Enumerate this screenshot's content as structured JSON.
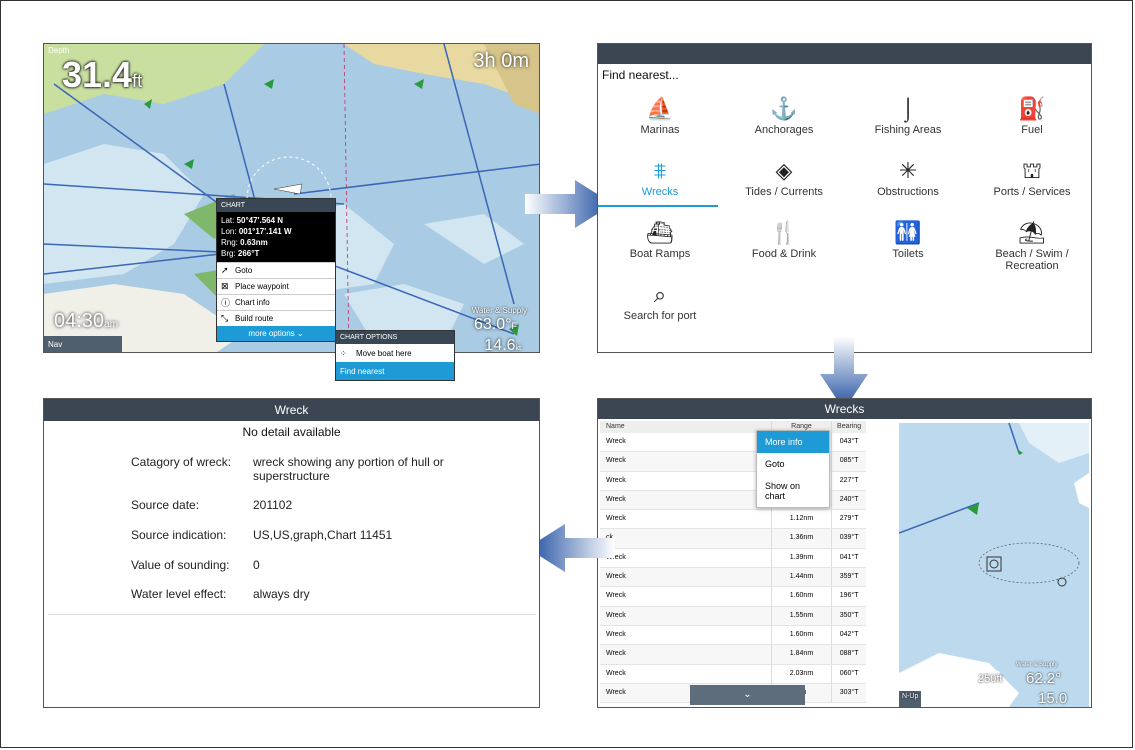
{
  "chart": {
    "depth_label": "Depth",
    "depth_value": "31.4",
    "depth_unit": "ft",
    "eta": "3h 0m",
    "time": "04:30",
    "time_suffix": "am",
    "water_label": "Water & Supply",
    "water_temp": "63.0°",
    "water_temp_unit": "F",
    "speed": "14.6",
    "speed_unit": "kt",
    "bottom_label": "Nav"
  },
  "context_menu": {
    "header": "CHART",
    "lat_label": "Lat:",
    "lat": "50°47'.564 N",
    "lon_label": "Lon:",
    "lon": "001°17'.141 W",
    "rng_label": "Rng:",
    "rng": "0.63nm",
    "brg_label": "Brg:",
    "brg": "266°T",
    "items": [
      "Goto",
      "Place waypoint",
      "Chart info",
      "Build route"
    ],
    "more": "more options"
  },
  "chart_options": {
    "header": "CHART OPTIONS",
    "items": [
      "Move boat here",
      "Find nearest"
    ]
  },
  "find_nearest": {
    "title": "Find nearest...",
    "items": [
      "Marinas",
      "Anchorages",
      "Fishing Areas",
      "Fuel",
      "Wrecks",
      "Tides / Currents",
      "Obstructions",
      "Ports / Services",
      "Boat Ramps",
      "Food & Drink",
      "Toilets",
      "Beach / Swim / Recreation",
      "Search for port"
    ],
    "selected": "Wrecks",
    "accent": "#1e9bd7"
  },
  "wreck_detail": {
    "title": "Wreck",
    "no_detail": "No detail available",
    "rows": [
      {
        "label": "Catagory of wreck:",
        "value": "wreck showing any portion of hull or superstructure"
      },
      {
        "label": "Source date:",
        "value": "201102"
      },
      {
        "label": "Source indication:",
        "value": "US,US,graph,Chart 11451"
      },
      {
        "label": "Value of sounding:",
        "value": "0"
      },
      {
        "label": "Water level effect:",
        "value": "always dry"
      }
    ]
  },
  "wrecks_list": {
    "title": "Wrecks",
    "headers": [
      "Name",
      "Range",
      "Bearing"
    ],
    "rows": [
      {
        "name": "Wreck",
        "range": "",
        "bearing": "043°T"
      },
      {
        "name": "Wreck",
        "range": "",
        "bearing": "085°T"
      },
      {
        "name": "Wreck",
        "range": "",
        "bearing": "227°T"
      },
      {
        "name": "Wreck",
        "range": "",
        "bearing": "240°T"
      },
      {
        "name": "Wreck",
        "range": "1.12nm",
        "bearing": "279°T"
      },
      {
        "name": "ck",
        "range": "1.36nm",
        "bearing": "039°T"
      },
      {
        "name": "Wreck",
        "range": "1.39nm",
        "bearing": "041°T"
      },
      {
        "name": "Wreck",
        "range": "1.44nm",
        "bearing": "359°T"
      },
      {
        "name": "Wreck",
        "range": "1.60nm",
        "bearing": "196°T"
      },
      {
        "name": "Wreck",
        "range": "1.55nm",
        "bearing": "350°T"
      },
      {
        "name": "Wreck",
        "range": "1.60nm",
        "bearing": "042°T"
      },
      {
        "name": "Wreck",
        "range": "1.84nm",
        "bearing": "088°T"
      },
      {
        "name": "Wreck",
        "range": "2.03nm",
        "bearing": "060°T"
      },
      {
        "name": "Wreck",
        "range": "nm",
        "bearing": "303°T"
      }
    ],
    "popup": [
      "More info",
      "Goto",
      "Show on chart"
    ],
    "map_scale": "250ft",
    "map_temp": "62.2°",
    "map_speed": "15.0",
    "map_water_label": "Water & Supply",
    "map_bottom": "N-Up"
  }
}
